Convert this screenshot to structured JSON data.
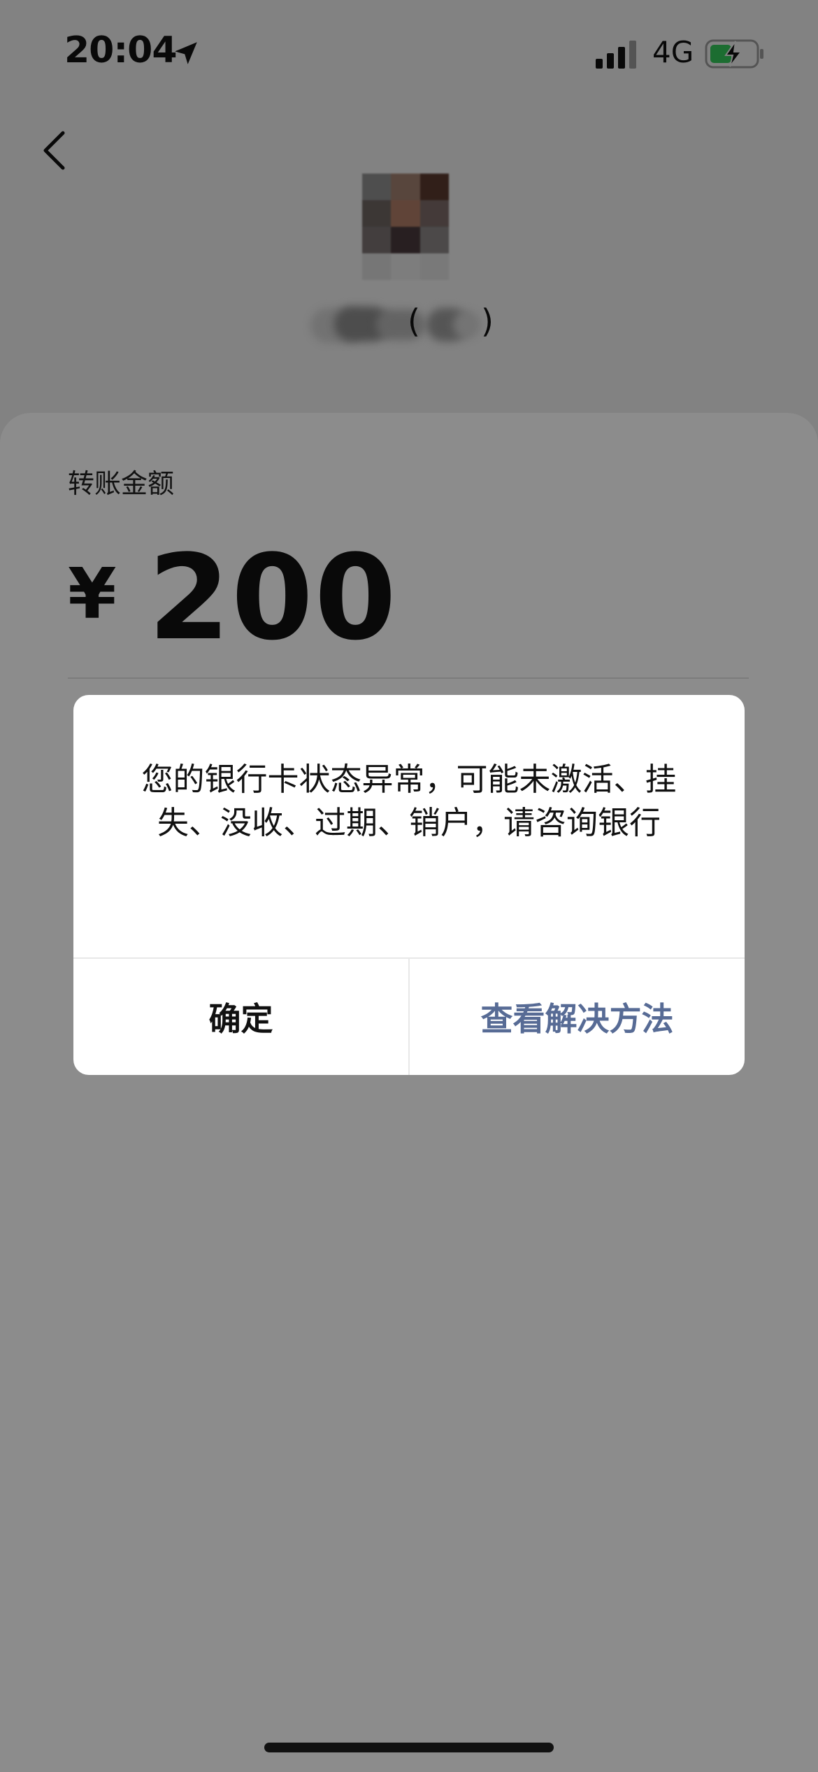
{
  "status_bar": {
    "time": "20:04",
    "network": "4G",
    "icons": [
      "location-arrow-icon",
      "signal-icon",
      "battery-charging-icon"
    ]
  },
  "header": {
    "back_icon": "chevron-left-icon",
    "recipient": {
      "avatar": "pixelated-avatar",
      "name_open_paren": "(",
      "name_close_paren": ")"
    }
  },
  "transfer": {
    "amount_label": "转账金额",
    "currency_symbol": "¥",
    "amount": "200"
  },
  "dialog": {
    "message": "您的银行卡状态异常，可能未激活、挂失、没收、过期、销户，请咨询银行",
    "confirm_label": "确定",
    "solution_label": "查看解决方法"
  },
  "colors": {
    "overlay": "rgba(0,0,0,0.45)",
    "link": "#576b95",
    "battery_fill": "#34c759"
  }
}
